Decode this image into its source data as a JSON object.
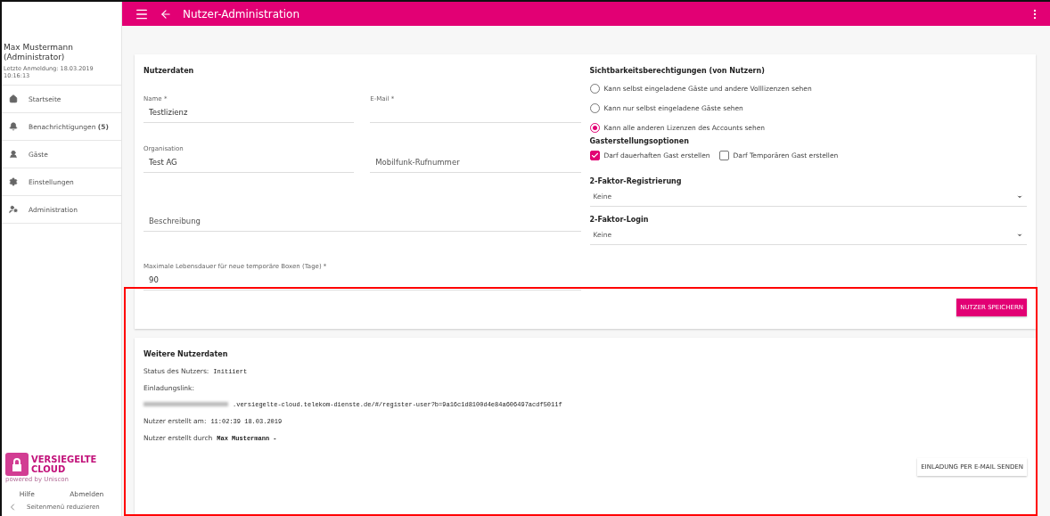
{
  "topbar": {
    "title": "Nutzer-Administration"
  },
  "sidebar": {
    "user_name": "Max Mustermann",
    "role": "(Administrator)",
    "last_login": "Letzte Anmeldung: 18.03.2019 10:16:13",
    "items": [
      {
        "label": "Startseite"
      },
      {
        "label": "Benachrichtigungen **(5)**"
      },
      {
        "label": "Gäste"
      },
      {
        "label": "Einstellungen"
      },
      {
        "label": "Administration"
      }
    ],
    "brand": {
      "line1": "VERSIEGELTE",
      "line2": "CLOUD",
      "tagline": "powered by Uniscon"
    },
    "links": [
      "Hilfe",
      "Abmelden"
    ],
    "collapse": "Seitenmenü reduzieren"
  },
  "user_data": {
    "title": "Nutzerdaten",
    "fields": [
      {
        "label": "Name *",
        "value": "Testlizienz",
        "wide": false
      },
      {
        "label": "E-Mail *",
        "wide": false
      },
      {
        "label": "Organisation",
        "value": "Test AG",
        "wide": false
      },
      {
        "placeholder": "Mobilfunk-Rufnummer",
        "wide": false
      },
      {
        "placeholder": "Beschreibung",
        "wide": true
      },
      {
        "label": "Maximale Lebensdauer für neue temporäre Boxen (Tage) *",
        "value": "90",
        "wide": true
      }
    ],
    "visibility": {
      "title": "Sichtbarkeitsberechtigungen (von Nutzern)",
      "options": [
        {
          "label": "Kann selbst eingeladene Gäste und andere Volllizenzen sehen",
          "selected": false
        },
        {
          "label": "Kann nur selbst eingeladene Gäste sehen",
          "selected": false
        },
        {
          "label": "Kann alle anderen Lizenzen des Accounts sehen",
          "selected": true
        }
      ]
    },
    "guest_options": {
      "title": "Gasterstellungsoptionen",
      "options": [
        {
          "label": "Darf dauerhaften Gast erstellen",
          "checked": true
        },
        {
          "label": "Darf Temporären Gast erstellen",
          "checked": false
        }
      ]
    },
    "selects": [
      {
        "title": "2-Faktor-Registrierung",
        "value": "Keine"
      },
      {
        "title": "2-Faktor-Login",
        "value": "Keine"
      }
    ],
    "save_button": "NUTZER SPEICHERN"
  },
  "more_data": {
    "title": "Weitere Nutzerdaten",
    "status": {
      "label": "Status des Nutzers:",
      "value": "Initiiert"
    },
    "link_label": "Einladungslink:",
    "link": ".versiegelte-cloud.telekom-dienste.de/#/register-user?b=9a16c1d8100d4e84a606497acdf5011f",
    "created_at": {
      "label": "Nutzer erstellt am:",
      "value": "11:02:39 18.03.2019"
    },
    "created_by": {
      "label": "Nutzer erstellt durch",
      "value": "Max Mustermann -"
    },
    "invite_button": "EINLADUNG PER E-MAIL SENDEN"
  }
}
